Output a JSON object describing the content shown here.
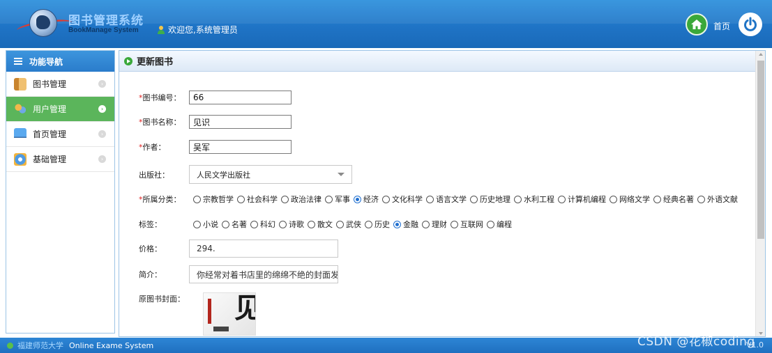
{
  "header": {
    "title": "图书管理系统",
    "subtitle": "BookManage System",
    "welcome": "欢迎您,系统管理员",
    "home_label": "首页"
  },
  "sidebar": {
    "title": "功能导航",
    "items": [
      {
        "label": "图书管理",
        "icon": "book-icon",
        "active": false
      },
      {
        "label": "用户管理",
        "icon": "users-icon",
        "active": true
      },
      {
        "label": "首页管理",
        "icon": "monitor-icon",
        "active": false
      },
      {
        "label": "基础管理",
        "icon": "gear-icon",
        "active": false
      }
    ]
  },
  "panel": {
    "title": "更新图书"
  },
  "form": {
    "book_id": {
      "label": "图书编号：",
      "required": true,
      "value": "66"
    },
    "book_name": {
      "label": "图书名称：",
      "required": true,
      "value": "见识"
    },
    "author": {
      "label": "作者：",
      "required": true,
      "value": "吴军"
    },
    "publisher": {
      "label": "出版社：",
      "value": "人民文学出版社"
    },
    "category": {
      "label": "所属分类：",
      "required": true,
      "options": [
        "宗教哲学",
        "社会科学",
        "政治法律",
        "军事",
        "经济",
        "文化科学",
        "语言文学",
        "历史地理",
        "水利工程",
        "计算机编程",
        "网络文学",
        "经典名著",
        "外语文献"
      ],
      "selected": "经济"
    },
    "tags": {
      "label": "标签：",
      "options": [
        "小说",
        "名著",
        "科幻",
        "诗歌",
        "散文",
        "武侠",
        "历史",
        "金融",
        "理财",
        "互联网",
        "编程"
      ],
      "selected": "金融"
    },
    "price": {
      "label": "价格：",
      "value": "294."
    },
    "intro": {
      "label": "简介：",
      "value": "你经常对着书店里的绵绵不绝的封面发"
    },
    "cover": {
      "label": "原图书封面：",
      "cover_text": "见"
    }
  },
  "footer": {
    "school": "福建师范大学",
    "system": "Online Exame System",
    "version": "V1.0"
  },
  "watermark": "CSDN @花椒coding",
  "colors": {
    "header_blue": "#1f74c6",
    "active_green": "#5bb55b",
    "required_red": "#e02020",
    "radio_blue": "#1f6fd0"
  }
}
